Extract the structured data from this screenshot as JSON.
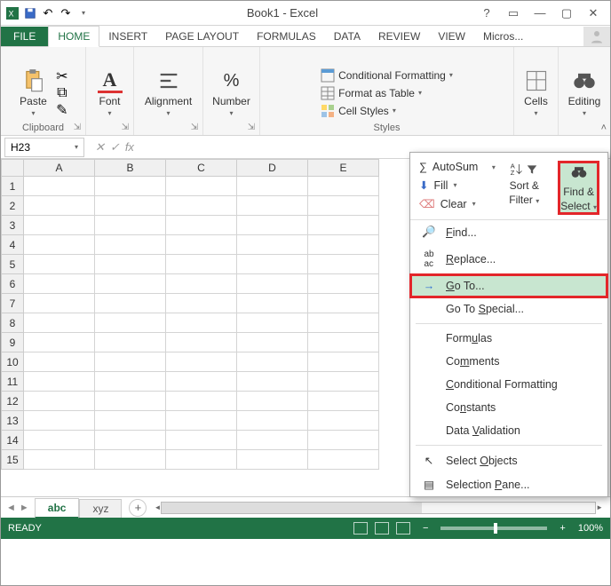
{
  "title": "Book1 - Excel",
  "tabs": {
    "file": "FILE",
    "home": "HOME",
    "insert": "INSERT",
    "pagelayout": "PAGE LAYOUT",
    "formulas": "FORMULAS",
    "data": "DATA",
    "review": "REVIEW",
    "view": "VIEW",
    "micro": "Micros..."
  },
  "ribbon": {
    "clipboard": {
      "paste": "Paste",
      "label": "Clipboard"
    },
    "font": {
      "label": "Font"
    },
    "alignment": {
      "label": "Alignment"
    },
    "number": {
      "label": "Number"
    },
    "styles": {
      "cond": "Conditional Formatting",
      "table": "Format as Table",
      "cell": "Cell Styles",
      "label": "Styles"
    },
    "cells": {
      "label": "Cells"
    },
    "editing": {
      "label": "Editing"
    }
  },
  "name_box": "H23",
  "columns": [
    "A",
    "B",
    "C",
    "D",
    "E"
  ],
  "rows": [
    "1",
    "2",
    "3",
    "4",
    "5",
    "6",
    "7",
    "8",
    "9",
    "10",
    "11",
    "12",
    "13",
    "14",
    "15"
  ],
  "sheets": {
    "active": "abc",
    "other": "xyz"
  },
  "status": {
    "ready": "READY",
    "zoom": "100%"
  },
  "popup": {
    "autosum": "AutoSum",
    "fill": "Fill",
    "clear": "Clear",
    "sort": "Sort &",
    "filter": "Filter",
    "find": "Find &",
    "select": "Select",
    "items": {
      "find_cmd": "Find...",
      "replace": "Replace...",
      "goto": "Go To...",
      "gotospecial": "Go To Special...",
      "formulas": "Formulas",
      "comments": "Comments",
      "condfmt": "Conditional Formatting",
      "constants": "Constants",
      "datavalid": "Data Validation",
      "selobj": "Select Objects",
      "selpane": "Selection Pane..."
    }
  }
}
